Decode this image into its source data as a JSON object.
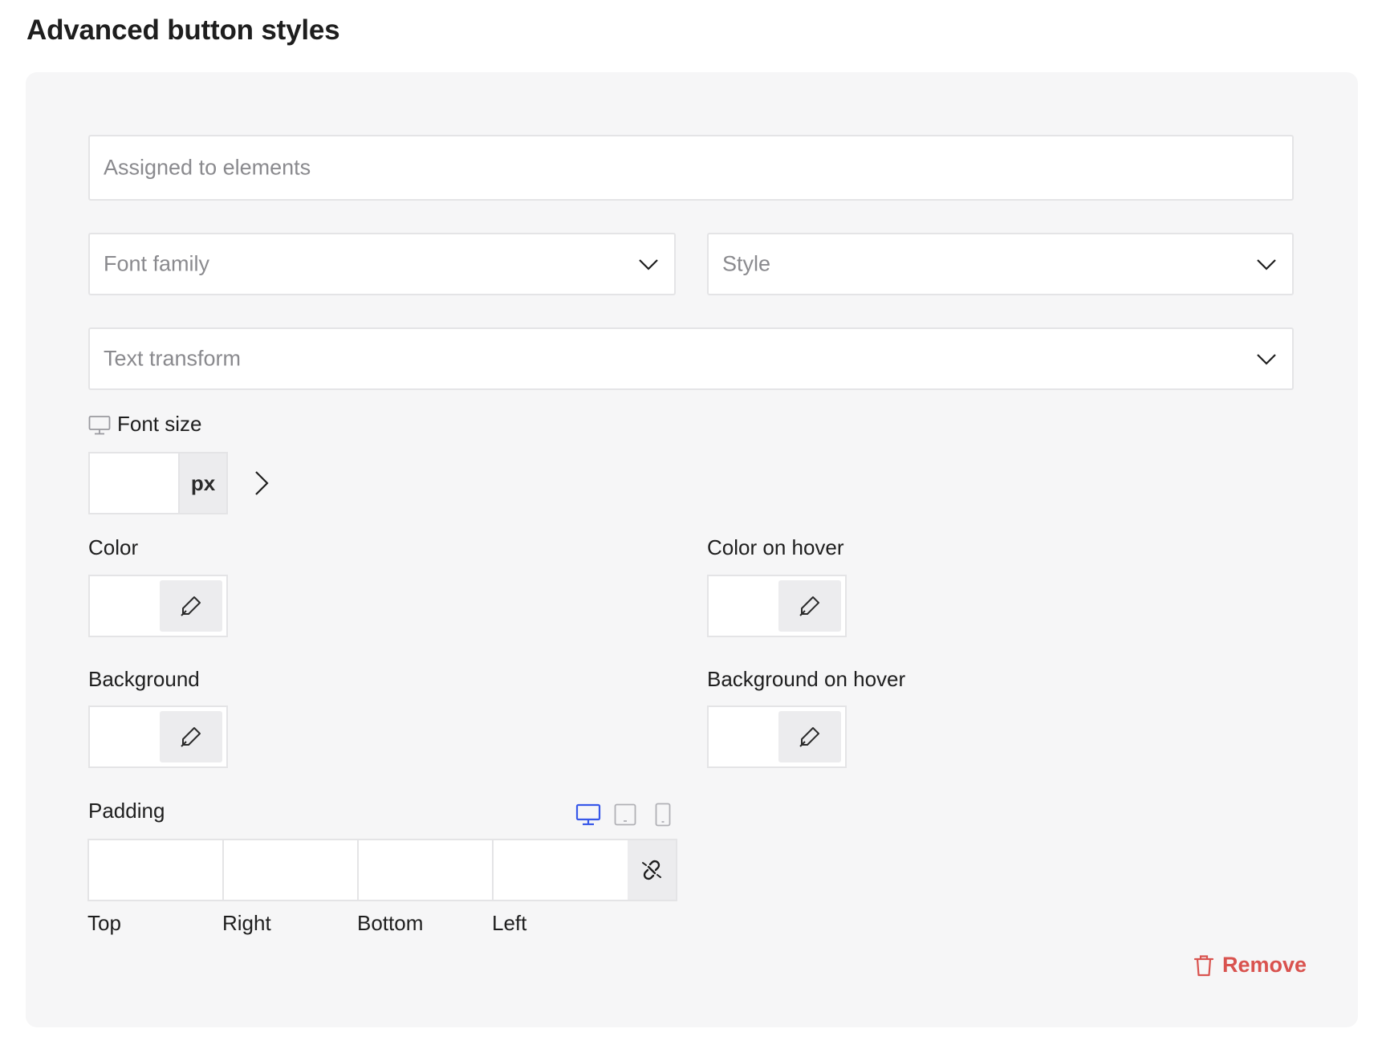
{
  "title": "Advanced button styles",
  "fields": {
    "assigned_placeholder": "Assigned to elements",
    "font_family_placeholder": "Font family",
    "style_placeholder": "Style",
    "text_transform_placeholder": "Text transform"
  },
  "font_size": {
    "label": "Font size",
    "value": "",
    "unit": "px"
  },
  "colors": {
    "color_label": "Color",
    "color_hover_label": "Color on hover",
    "background_label": "Background",
    "background_hover_label": "Background on hover"
  },
  "padding": {
    "label": "Padding",
    "sides": [
      "Top",
      "Right",
      "Bottom",
      "Left"
    ],
    "active_device": "desktop",
    "active_color": "#3858e9"
  },
  "remove_label": "Remove",
  "accent_danger": "#d9534f",
  "icons": {
    "dropdown": "chevron-down-icon",
    "expand": "chevron-right-icon",
    "picker": "eyedropper-icon",
    "link": "unlink-icon",
    "delete": "trash-icon"
  }
}
